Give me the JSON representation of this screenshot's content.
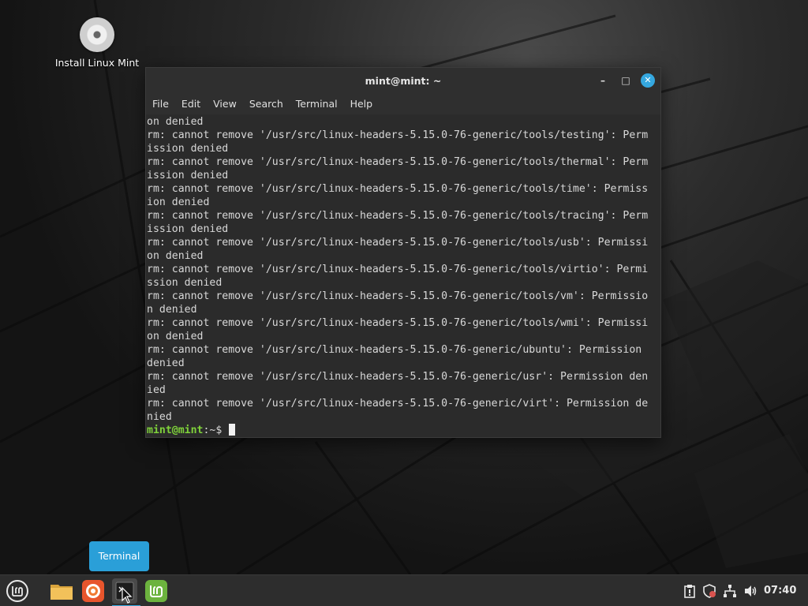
{
  "desktop": {
    "icons": [
      {
        "label": "Install Linux Mint",
        "icon": "cd-disc-icon"
      }
    ]
  },
  "terminal": {
    "title": "mint@mint: ~",
    "window_buttons": {
      "minimize": "–",
      "maximize": "□",
      "close": "✕"
    },
    "menu": [
      "File",
      "Edit",
      "View",
      "Search",
      "Terminal",
      "Help"
    ],
    "lines": [
      "on denied",
      "rm: cannot remove '/usr/src/linux-headers-5.15.0-76-generic/tools/testing': Perm",
      "ission denied",
      "rm: cannot remove '/usr/src/linux-headers-5.15.0-76-generic/tools/thermal': Perm",
      "ission denied",
      "rm: cannot remove '/usr/src/linux-headers-5.15.0-76-generic/tools/time': Permiss",
      "ion denied",
      "rm: cannot remove '/usr/src/linux-headers-5.15.0-76-generic/tools/tracing': Perm",
      "ission denied",
      "rm: cannot remove '/usr/src/linux-headers-5.15.0-76-generic/tools/usb': Permissi",
      "on denied",
      "rm: cannot remove '/usr/src/linux-headers-5.15.0-76-generic/tools/virtio': Permi",
      "ssion denied",
      "rm: cannot remove '/usr/src/linux-headers-5.15.0-76-generic/tools/vm': Permissio",
      "n denied",
      "rm: cannot remove '/usr/src/linux-headers-5.15.0-76-generic/tools/wmi': Permissi",
      "on denied",
      "rm: cannot remove '/usr/src/linux-headers-5.15.0-76-generic/ubuntu': Permission ",
      "denied",
      "rm: cannot remove '/usr/src/linux-headers-5.15.0-76-generic/usr': Permission den",
      "ied",
      "rm: cannot remove '/usr/src/linux-headers-5.15.0-76-generic/virt': Permission de",
      "nied"
    ],
    "prompt": {
      "user_host": "mint@mint",
      "separator": ":",
      "path": "~",
      "symbol": "$ "
    }
  },
  "tooltip": {
    "text": "Terminal"
  },
  "panel": {
    "launchers": [
      {
        "name": "menu",
        "icon": "mint-menu-icon"
      },
      {
        "name": "files",
        "icon": "folder-icon"
      },
      {
        "name": "firefox",
        "icon": "firefox-icon"
      },
      {
        "name": "terminal",
        "icon": "terminal-icon",
        "active": true
      },
      {
        "name": "mintinstall",
        "icon": "mint-logo-icon"
      }
    ],
    "tray": [
      "clipboard-icon",
      "shield-icon",
      "network-icon",
      "volume-icon"
    ],
    "clock": "07:40"
  },
  "colors": {
    "accent": "#35a8e0",
    "prompt_user": "#7fd23a",
    "terminal_bg": "#2b2b2b"
  }
}
